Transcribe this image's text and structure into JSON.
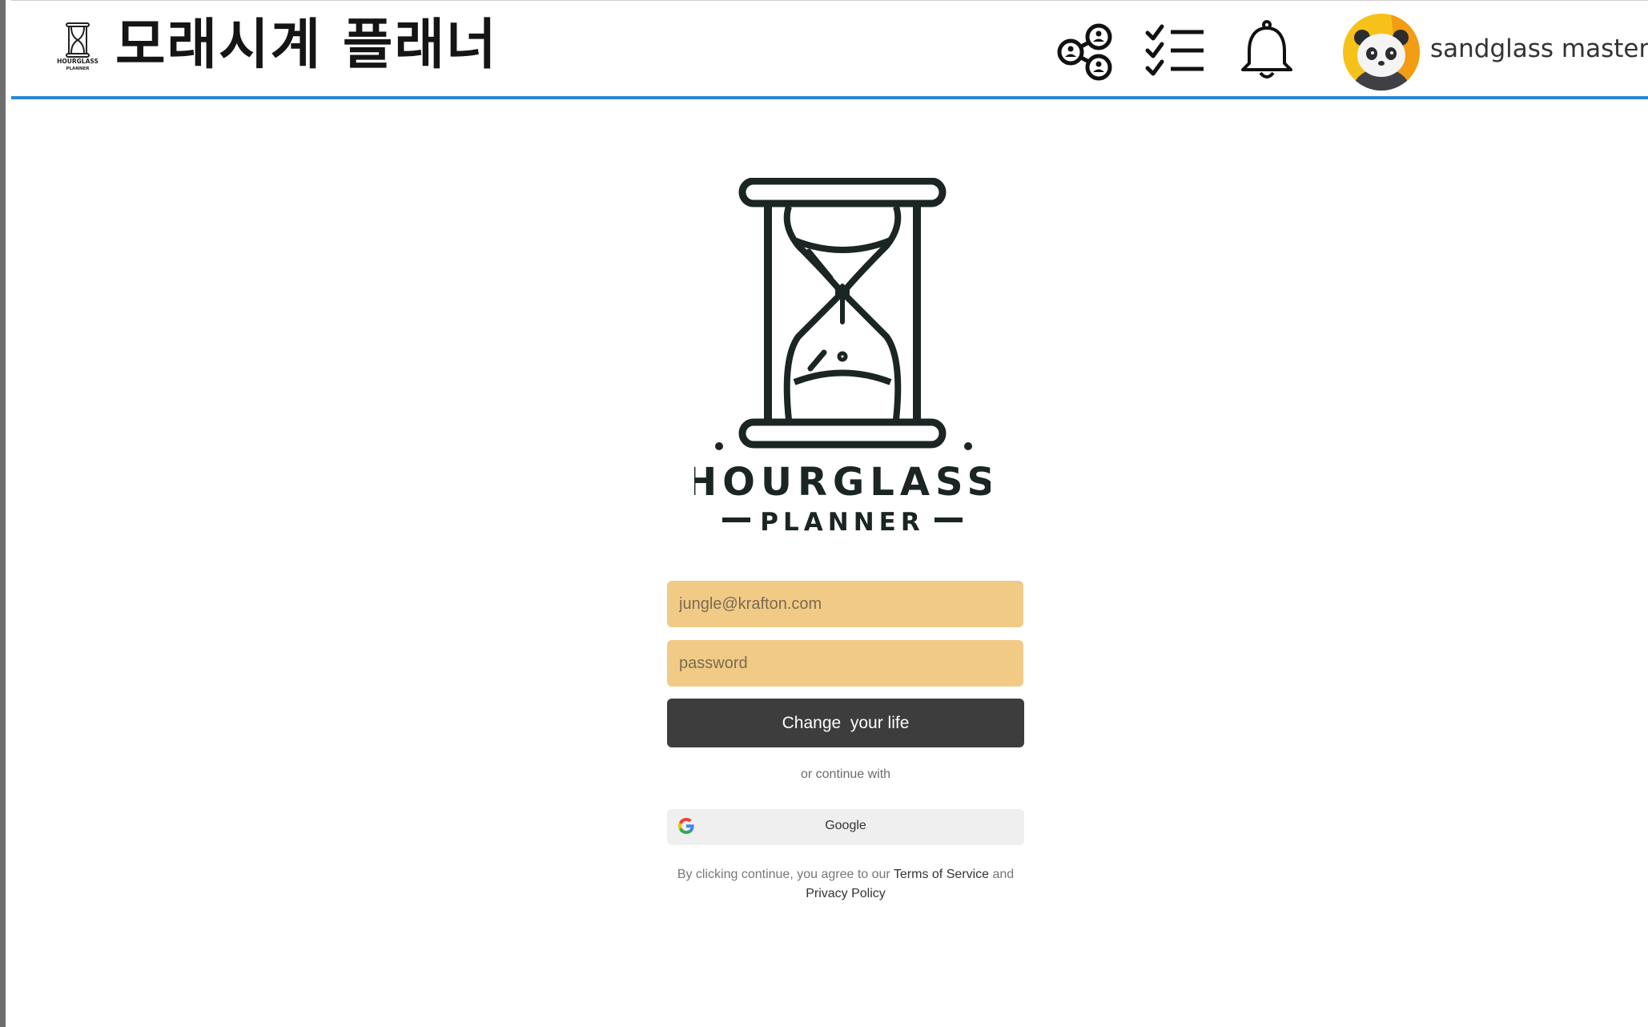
{
  "header": {
    "app_title": "모래시계 플래너",
    "logo_text_top": "HOURGLASS",
    "logo_text_bottom": "PLANNER",
    "icons": [
      "share-network-icon",
      "checklist-icon",
      "bell-icon"
    ],
    "username": "sandglass master"
  },
  "main": {
    "logo": {
      "title": "HOURGLASS",
      "subtitle": "PLANNER"
    },
    "form": {
      "email_placeholder": "jungle@krafton.com",
      "email_value": "",
      "password_placeholder": "password",
      "password_value": "",
      "submit_label": "Change  your life",
      "divider_text": "or continue with",
      "google_label": "Google"
    },
    "legal": {
      "prefix": "By clicking continue, you agree to our ",
      "terms_link": "Terms of Service",
      "middle": " and",
      "privacy_link": "Privacy Policy"
    }
  },
  "colors": {
    "header_border": "#2a86d6",
    "input_bg": "#f1cb86",
    "button_bg": "#3d3d3d",
    "google_btn_bg": "#efefef",
    "avatar_bg": "#f6c21a"
  }
}
